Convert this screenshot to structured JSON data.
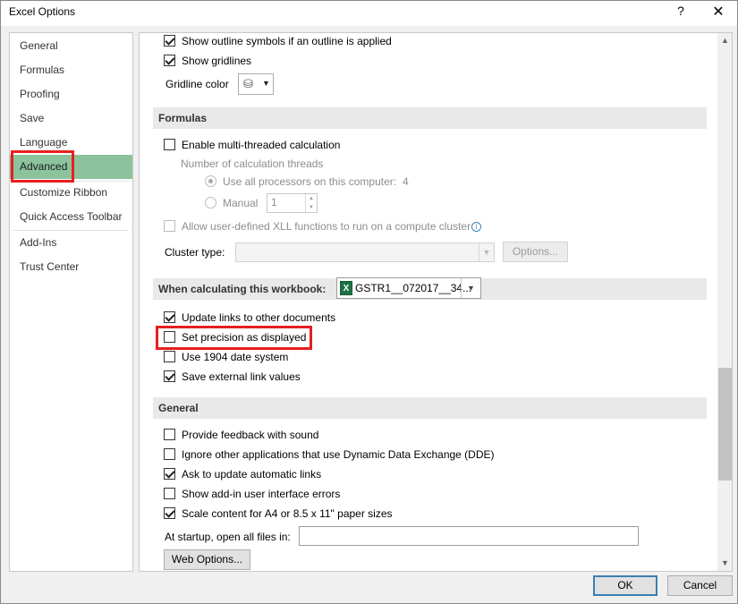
{
  "window": {
    "title": "Excel Options",
    "help_glyph": "?",
    "close_glyph": "✕"
  },
  "sidebar": {
    "items": [
      {
        "label": "General"
      },
      {
        "label": "Formulas"
      },
      {
        "label": "Proofing"
      },
      {
        "label": "Save"
      },
      {
        "label": "Language"
      },
      {
        "label": "Advanced",
        "selected": true
      },
      {
        "label": "Customize Ribbon"
      },
      {
        "label": "Quick Access Toolbar"
      },
      {
        "label": "Add-Ins"
      },
      {
        "label": "Trust Center"
      }
    ]
  },
  "display": {
    "outline_symbols": {
      "label": "Show outline symbols if an outline is applied",
      "checked": true
    },
    "gridlines": {
      "label": "Show gridlines",
      "checked": true
    },
    "gridline_color_label": "Gridline color"
  },
  "formulas": {
    "header": "Formulas",
    "multithread": {
      "label": "Enable multi-threaded calculation",
      "checked": false
    },
    "threads_label": "Number of calculation threads",
    "all_processors": {
      "label": "Use all processors on this computer:",
      "value": "4",
      "selected": true
    },
    "manual": {
      "label": "Manual",
      "value": "1"
    },
    "xll": {
      "label": "Allow user-defined XLL functions to run on a compute cluster",
      "info_glyph": "i"
    },
    "cluster_label": "Cluster type:",
    "options_button": "Options..."
  },
  "workbook": {
    "header": "When calculating this workbook:",
    "selected_workbook": "GSTR1__072017__34...",
    "update_links": {
      "label": "Update links to other documents",
      "checked": true
    },
    "precision": {
      "label": "Set precision as displayed",
      "checked": false
    },
    "date1904": {
      "label": "Use 1904 date system",
      "checked": false
    },
    "external_links": {
      "label": "Save external link values",
      "checked": true
    }
  },
  "general": {
    "header": "General",
    "feedback_sound": {
      "label": "Provide feedback with sound",
      "checked": false
    },
    "ignore_dde": {
      "label": "Ignore other applications that use Dynamic Data Exchange (DDE)",
      "checked": false
    },
    "update_auto_links": {
      "label": "Ask to update automatic links",
      "checked": true
    },
    "addin_errors": {
      "label": "Show add-in user interface errors",
      "checked": false
    },
    "scale_content": {
      "label": "Scale content for A4 or 8.5 x 11\" paper sizes",
      "checked": true
    },
    "startup_label": "At startup, open all files in:",
    "startup_value": "",
    "web_options_button": "Web Options..."
  },
  "footer": {
    "ok_label": "OK",
    "cancel_label": "Cancel"
  },
  "colors": {
    "selected_nav": "#8cc39d",
    "highlight_box": "#e81e1e",
    "excel_green": "#1e7145"
  }
}
